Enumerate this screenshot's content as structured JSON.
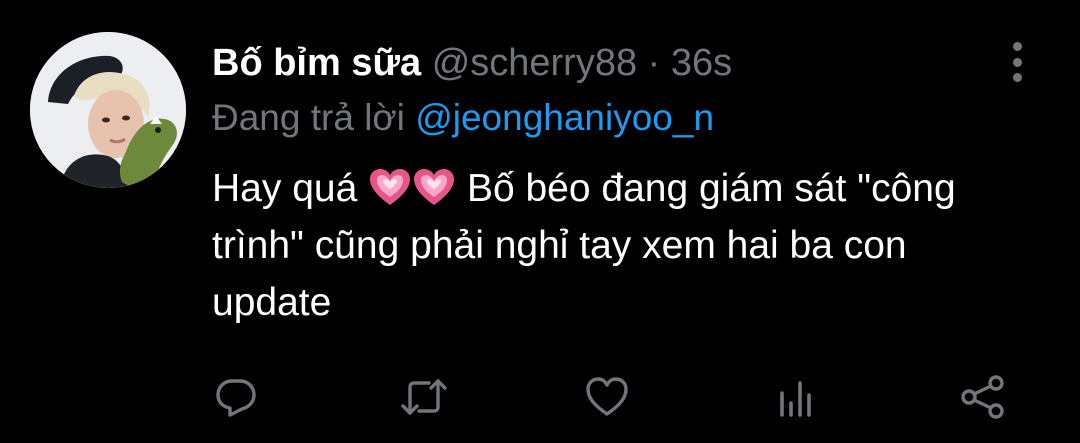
{
  "tweet": {
    "display_name": "Bố bỉm sữa",
    "handle": "@scherry88",
    "separator": "·",
    "time": "36s",
    "reply_prefix": "Đang trả lời",
    "reply_to": "@jeonghaniyoo_n",
    "text_part1": "Hay quá",
    "text_part2": "Bố béo đang giám sát \"công trình\" cũng phải nghỉ tay xem hai ba con update"
  },
  "colors": {
    "background": "#000000",
    "secondary_text": "#71767b",
    "mention": "#1d9bf0",
    "heart_emoji": "#e8558d"
  },
  "icons": {
    "reply": "reply-icon",
    "retweet": "retweet-icon",
    "like": "heart-icon",
    "views": "analytics-icon",
    "share": "share-icon",
    "more": "more-icon"
  }
}
